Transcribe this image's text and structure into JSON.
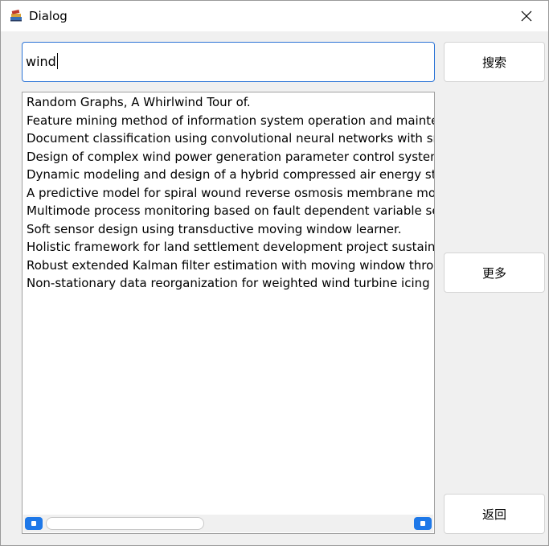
{
  "window": {
    "title": "Dialog",
    "app_icon": "books-icon",
    "close_icon": "close-icon"
  },
  "search": {
    "value": "wind",
    "button_label": "搜索"
  },
  "results": {
    "items": [
      "Random Graphs, A Whirlwind Tour of.",
      "Feature mining method of information system operation and maintena",
      "Document classification using convolutional neural networks with smal",
      "Design of complex wind power generation parameter control system b",
      "Dynamic modeling and design of a hybrid compressed air energy stora",
      "A predictive model for spiral wound reverse osmosis membrane modu",
      "Multimode process monitoring based on fault dependent variable sele",
      "Soft sensor design using transductive moving window learner.",
      "Holistic framework for land settlement development project sustainabi",
      "Robust extended Kalman filter estimation with moving window through",
      "Non-stationary data reorganization for weighted wind turbine icing mo"
    ]
  },
  "actions": {
    "more_label": "更多",
    "back_label": "返回"
  },
  "colors": {
    "accent": "#2b73d6",
    "scroll_button": "#1e78e8",
    "window_bg": "#f0f0f0"
  }
}
